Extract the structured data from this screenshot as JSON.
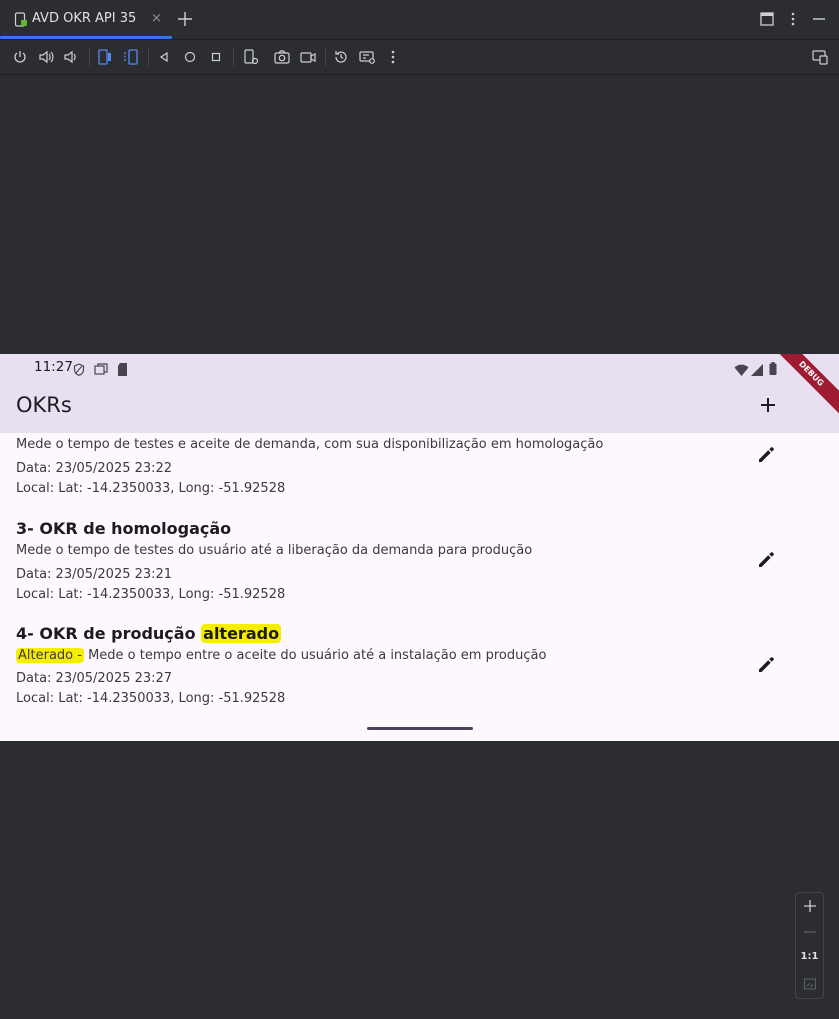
{
  "tab": {
    "title": "AVD OKR API 35",
    "close": "×"
  },
  "status": {
    "time": "11:27"
  },
  "app": {
    "title": "OKRs",
    "debug": "DEBUG"
  },
  "okrs": [
    {
      "description": "Mede o tempo de testes e aceite de demanda, com sua disponibilização em homologação",
      "date": "Data: 23/05/2025 23:22",
      "location": "Local: Lat: -14.2350033, Long: -51.92528"
    },
    {
      "title": "3- OKR de homologação",
      "description": "Mede o tempo de testes do usuário até a liberação da demanda para produção",
      "date": "Data: 23/05/2025 23:21",
      "location": "Local: Lat: -14.2350033, Long: -51.92528"
    },
    {
      "title_a": "4- OKR de produção ",
      "title_b": "alterado",
      "desc_a": "Alterado -",
      "desc_b": " Mede o tempo entre o aceite do usuário até a instalação em produção",
      "date": "Data: 23/05/2025 23:27",
      "location": "Local: Lat: -14.2350033, Long: -51.92528"
    }
  ],
  "zoom": {
    "ratio": "1:1"
  },
  "colors": {
    "accent": "#3574f0",
    "highlight": "#f5ee00",
    "appbar": "#e8e0f0",
    "debug": "#9e1b32"
  }
}
